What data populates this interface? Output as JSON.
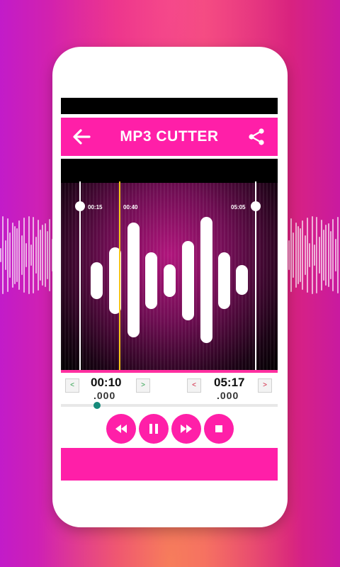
{
  "app": {
    "title": "MP3 CUTTER"
  },
  "toolbar": {
    "back_icon": "arrow-left-icon",
    "share_icon": "share-icon"
  },
  "waveform": {
    "start_label": "00:15",
    "current_label": "00:40",
    "end_label": "05:05"
  },
  "selection": {
    "start_time": "00:10",
    "start_ms": ".000",
    "end_time": "05:17",
    "end_ms": ".000",
    "decrease_symbol": "<",
    "increase_symbol": ">"
  },
  "playback": {
    "buttons": [
      "rewind-icon",
      "pause-icon",
      "fast-forward-icon",
      "stop-icon"
    ]
  },
  "colors": {
    "accent": "#ff1fa8",
    "seek_knob": "#168a7a",
    "playhead": "#f5c518"
  }
}
